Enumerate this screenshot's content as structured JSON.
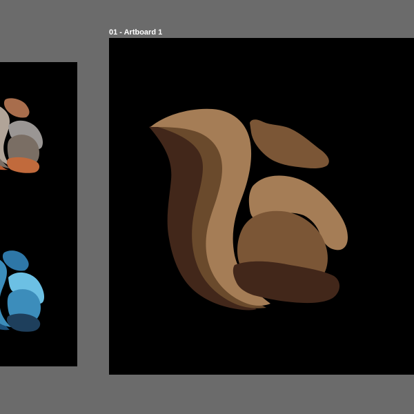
{
  "canvas": {
    "background_color": "#6b6b6b"
  },
  "artboards": [
    {
      "label": "",
      "background_color": "#000000",
      "artwork": [
        "squirrel-orange-variant-icon",
        "squirrel-blue-variant-icon"
      ]
    },
    {
      "label": "01 - Artboard 1",
      "background_color": "#000000",
      "artwork": [
        "squirrel-brown-logo-icon"
      ]
    }
  ],
  "palettes": {
    "brown": {
      "tail_light": "#a57d56",
      "tail_mid": "#6a4a2c",
      "tail_dark": "#42271a",
      "head": "#7b5636",
      "body_light": "#a57d56",
      "body_dark": "#42271a"
    },
    "orange": {
      "tail_light": "#b1a498",
      "tail_mid": "#7a6e64",
      "tail_dark": "#b55a30",
      "head": "#a86d4c",
      "body_light": "#9a9694",
      "body_dark": "#c16a3c"
    },
    "blue": {
      "tail_light": "#5aaed3",
      "tail_mid": "#3c8dbb",
      "tail_dark": "#1c4f78",
      "head": "#2e77a7",
      "body_light": "#6cc0e4",
      "body_dark": "#1e3f5c"
    }
  }
}
